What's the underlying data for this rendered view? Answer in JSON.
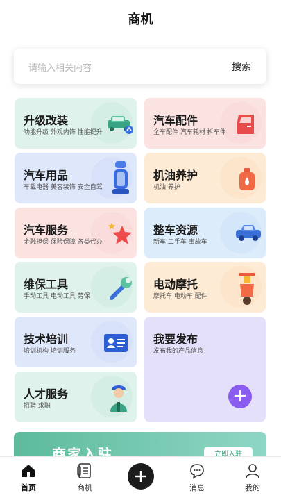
{
  "page": {
    "title": "商机"
  },
  "search": {
    "placeholder": "请输入相关内容",
    "button": "搜索"
  },
  "categories": [
    {
      "title": "升级改装",
      "subtitle": "功能升级 外观内饰 性能提升",
      "icon": "car-upgrade-icon"
    },
    {
      "title": "汽车配件",
      "subtitle": "全车配件 汽车耗材 拆车件",
      "icon": "car-door-icon"
    },
    {
      "title": "汽车用品",
      "subtitle": "车载电器 美容装饰 安全自驾",
      "icon": "car-seat-icon"
    },
    {
      "title": "机油养护",
      "subtitle": "机油 养护",
      "icon": "oil-bottle-icon"
    },
    {
      "title": "汽车服务",
      "subtitle": "金融担保 保险保障 各类代办",
      "icon": "star-icon"
    },
    {
      "title": "整车资源",
      "subtitle": "新车 二手车 事故车",
      "icon": "car-icon"
    },
    {
      "title": "维保工具",
      "subtitle": "手动工具 电动工具 劳保",
      "icon": "wrench-icon"
    },
    {
      "title": "电动摩托",
      "subtitle": "摩托车 电动车 配件",
      "icon": "scooter-icon"
    },
    {
      "title": "技术培训",
      "subtitle": "培训机构 培训服务",
      "icon": "id-card-icon"
    },
    {
      "title": "我要发布",
      "subtitle": "发布我的产品信息",
      "icon": "plus-icon"
    },
    {
      "title": "人才服务",
      "subtitle": "招聘 求职",
      "icon": "worker-icon"
    }
  ],
  "banner": {
    "title": "商家入驻",
    "button": "立即入驻"
  },
  "tabbar": {
    "home": "首页",
    "business": "商机",
    "messages": "消息",
    "mine": "我的"
  },
  "colors": {
    "accent": "#8a5cf0",
    "banner": "#5dbb9c",
    "dark": "#1c1c1c"
  }
}
